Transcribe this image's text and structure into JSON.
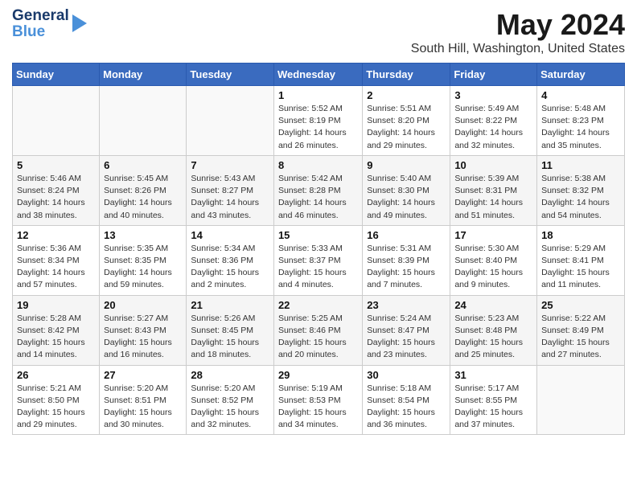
{
  "header": {
    "logo_line1": "General",
    "logo_line2": "Blue",
    "title": "May 2024",
    "location": "South Hill, Washington, United States"
  },
  "days_of_week": [
    "Sunday",
    "Monday",
    "Tuesday",
    "Wednesday",
    "Thursday",
    "Friday",
    "Saturday"
  ],
  "weeks": [
    [
      {
        "day": "",
        "info": ""
      },
      {
        "day": "",
        "info": ""
      },
      {
        "day": "",
        "info": ""
      },
      {
        "day": "1",
        "info": "Sunrise: 5:52 AM\nSunset: 8:19 PM\nDaylight: 14 hours and 26 minutes."
      },
      {
        "day": "2",
        "info": "Sunrise: 5:51 AM\nSunset: 8:20 PM\nDaylight: 14 hours and 29 minutes."
      },
      {
        "day": "3",
        "info": "Sunrise: 5:49 AM\nSunset: 8:22 PM\nDaylight: 14 hours and 32 minutes."
      },
      {
        "day": "4",
        "info": "Sunrise: 5:48 AM\nSunset: 8:23 PM\nDaylight: 14 hours and 35 minutes."
      }
    ],
    [
      {
        "day": "5",
        "info": "Sunrise: 5:46 AM\nSunset: 8:24 PM\nDaylight: 14 hours and 38 minutes."
      },
      {
        "day": "6",
        "info": "Sunrise: 5:45 AM\nSunset: 8:26 PM\nDaylight: 14 hours and 40 minutes."
      },
      {
        "day": "7",
        "info": "Sunrise: 5:43 AM\nSunset: 8:27 PM\nDaylight: 14 hours and 43 minutes."
      },
      {
        "day": "8",
        "info": "Sunrise: 5:42 AM\nSunset: 8:28 PM\nDaylight: 14 hours and 46 minutes."
      },
      {
        "day": "9",
        "info": "Sunrise: 5:40 AM\nSunset: 8:30 PM\nDaylight: 14 hours and 49 minutes."
      },
      {
        "day": "10",
        "info": "Sunrise: 5:39 AM\nSunset: 8:31 PM\nDaylight: 14 hours and 51 minutes."
      },
      {
        "day": "11",
        "info": "Sunrise: 5:38 AM\nSunset: 8:32 PM\nDaylight: 14 hours and 54 minutes."
      }
    ],
    [
      {
        "day": "12",
        "info": "Sunrise: 5:36 AM\nSunset: 8:34 PM\nDaylight: 14 hours and 57 minutes."
      },
      {
        "day": "13",
        "info": "Sunrise: 5:35 AM\nSunset: 8:35 PM\nDaylight: 14 hours and 59 minutes."
      },
      {
        "day": "14",
        "info": "Sunrise: 5:34 AM\nSunset: 8:36 PM\nDaylight: 15 hours and 2 minutes."
      },
      {
        "day": "15",
        "info": "Sunrise: 5:33 AM\nSunset: 8:37 PM\nDaylight: 15 hours and 4 minutes."
      },
      {
        "day": "16",
        "info": "Sunrise: 5:31 AM\nSunset: 8:39 PM\nDaylight: 15 hours and 7 minutes."
      },
      {
        "day": "17",
        "info": "Sunrise: 5:30 AM\nSunset: 8:40 PM\nDaylight: 15 hours and 9 minutes."
      },
      {
        "day": "18",
        "info": "Sunrise: 5:29 AM\nSunset: 8:41 PM\nDaylight: 15 hours and 11 minutes."
      }
    ],
    [
      {
        "day": "19",
        "info": "Sunrise: 5:28 AM\nSunset: 8:42 PM\nDaylight: 15 hours and 14 minutes."
      },
      {
        "day": "20",
        "info": "Sunrise: 5:27 AM\nSunset: 8:43 PM\nDaylight: 15 hours and 16 minutes."
      },
      {
        "day": "21",
        "info": "Sunrise: 5:26 AM\nSunset: 8:45 PM\nDaylight: 15 hours and 18 minutes."
      },
      {
        "day": "22",
        "info": "Sunrise: 5:25 AM\nSunset: 8:46 PM\nDaylight: 15 hours and 20 minutes."
      },
      {
        "day": "23",
        "info": "Sunrise: 5:24 AM\nSunset: 8:47 PM\nDaylight: 15 hours and 23 minutes."
      },
      {
        "day": "24",
        "info": "Sunrise: 5:23 AM\nSunset: 8:48 PM\nDaylight: 15 hours and 25 minutes."
      },
      {
        "day": "25",
        "info": "Sunrise: 5:22 AM\nSunset: 8:49 PM\nDaylight: 15 hours and 27 minutes."
      }
    ],
    [
      {
        "day": "26",
        "info": "Sunrise: 5:21 AM\nSunset: 8:50 PM\nDaylight: 15 hours and 29 minutes."
      },
      {
        "day": "27",
        "info": "Sunrise: 5:20 AM\nSunset: 8:51 PM\nDaylight: 15 hours and 30 minutes."
      },
      {
        "day": "28",
        "info": "Sunrise: 5:20 AM\nSunset: 8:52 PM\nDaylight: 15 hours and 32 minutes."
      },
      {
        "day": "29",
        "info": "Sunrise: 5:19 AM\nSunset: 8:53 PM\nDaylight: 15 hours and 34 minutes."
      },
      {
        "day": "30",
        "info": "Sunrise: 5:18 AM\nSunset: 8:54 PM\nDaylight: 15 hours and 36 minutes."
      },
      {
        "day": "31",
        "info": "Sunrise: 5:17 AM\nSunset: 8:55 PM\nDaylight: 15 hours and 37 minutes."
      },
      {
        "day": "",
        "info": ""
      }
    ]
  ]
}
